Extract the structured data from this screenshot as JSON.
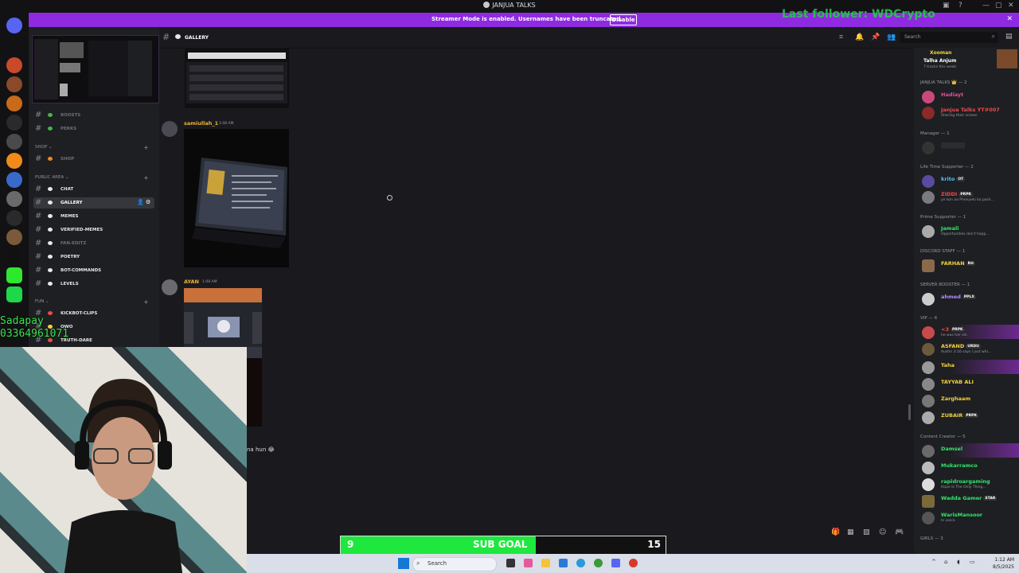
{
  "window": {
    "title": "JANJUA TALKS",
    "controls": [
      "—",
      "▢",
      "✕"
    ]
  },
  "overlays": {
    "last_follower": "Last follower: WDCrypto",
    "donation_name": "Sadapay",
    "donation_number": "03364961071"
  },
  "banner": {
    "message": "Streamer Mode is enabled. Usernames have been truncated.",
    "disable_label": "Disable"
  },
  "channels": [
    {
      "label": "BOOSTS",
      "style": "dim"
    },
    {
      "label": "PERKS",
      "style": "dim"
    },
    {
      "type": "category",
      "label": "SHOP"
    },
    {
      "label": "SHOP",
      "style": "dim"
    },
    {
      "type": "category",
      "label": "PUBLIC AREA"
    },
    {
      "label": "CHAT",
      "style": "bright"
    },
    {
      "label": "GALLERY",
      "style": "active"
    },
    {
      "label": "MEMES",
      "style": "bright"
    },
    {
      "label": "VERIFIED-MEMES",
      "style": "bright"
    },
    {
      "label": "FAN-EDITZ",
      "style": "dim"
    },
    {
      "label": "POETRY",
      "style": "bright"
    },
    {
      "label": "BOT-COMMANDS",
      "style": "bright"
    },
    {
      "label": "LEVELS",
      "style": "bright"
    },
    {
      "type": "category",
      "label": "FUN"
    },
    {
      "label": "KICKBOT-CLIPS",
      "style": "bright"
    },
    {
      "label": "OWO",
      "style": "bright"
    },
    {
      "label": "TRUTH-DARE",
      "style": "bright"
    }
  ],
  "header": {
    "channel": "GALLERY",
    "search_placeholder": "Search"
  },
  "messages": [
    {
      "author": "samiullah_1",
      "time": "1:08 AM"
    },
    {
      "author": "AYAN",
      "time": "1:08 AM"
    }
  ],
  "partial_text": "na hun 😂",
  "members": {
    "top": {
      "name": "Xooman",
      "second": "Talha Anjum",
      "status": "7 tracks this week"
    },
    "groups": [
      {
        "label": "JANJUA TALKS 👑 — 2"
      },
      {
        "label": "Manager — 1"
      },
      {
        "label": "Life Time Supporter — 2"
      },
      {
        "label": "Prime Supporter — 1"
      },
      {
        "label": "DISCORD STAFF — 1"
      },
      {
        "label": "SERVER BOOSTER — 1"
      },
      {
        "label": "VIP — 6"
      },
      {
        "label": "Content Creator — 5"
      },
      {
        "label": "GIRLS — 3"
      }
    ],
    "list": [
      {
        "name": "Hadiayt",
        "color": "#e94c9a"
      },
      {
        "name": "Janjua Talks YT#007",
        "color": "#e94c4c",
        "status": "Sharing their screen"
      },
      {
        "name": "krito",
        "color": "#4fc3f7",
        "tag": "OT"
      },
      {
        "name": "ZIDDI",
        "color": "#e94c4c",
        "tag": "PRPK",
        "status": "ye kon aa Phenyeki ka pack..."
      },
      {
        "name": "Jamali",
        "color": "#2ee86b",
        "status": "Opportunities don't happ..."
      },
      {
        "name": "FARHAN",
        "color": "#f5d33b",
        "tag": "RH"
      },
      {
        "name": "ahmed",
        "color": "#b38cff",
        "tag": "PPLX"
      },
      {
        "name": "<3",
        "color": "#e94c4c",
        "tag": "PRPK",
        "status": "he was her sin"
      },
      {
        "name": "ASFAND",
        "color": "#f5d33b",
        "tag": "URDU",
        "status": "Austin 3:16 says I just whi..."
      },
      {
        "name": "Taha",
        "color": "#f5d33b"
      },
      {
        "name": "TAYYAB ALI",
        "color": "#f5d33b"
      },
      {
        "name": "Zarghaam",
        "color": "#f5d33b"
      },
      {
        "name": "ZUBAIR",
        "color": "#f5d33b",
        "tag": "PRPK"
      },
      {
        "name": "Damsel",
        "color": "#2ee86b"
      },
      {
        "name": "Mukarramco",
        "color": "#2ee86b"
      },
      {
        "name": "rapidroargaming",
        "color": "#2ee86b",
        "status": "Hope Is The Only Thing..."
      },
      {
        "name": "Wadda Gamer",
        "color": "#2ee86b",
        "tag": "STAR"
      },
      {
        "name": "WarisMansoor",
        "color": "#2ee86b",
        "status": "In voice"
      }
    ]
  },
  "sub_goal": {
    "current": "9",
    "label": "SUB GOAL",
    "target": "15",
    "fraction": 0.6
  },
  "taskbar": {
    "search_placeholder": "Search",
    "time": "1:12 AM",
    "date": "8/5/2025"
  }
}
